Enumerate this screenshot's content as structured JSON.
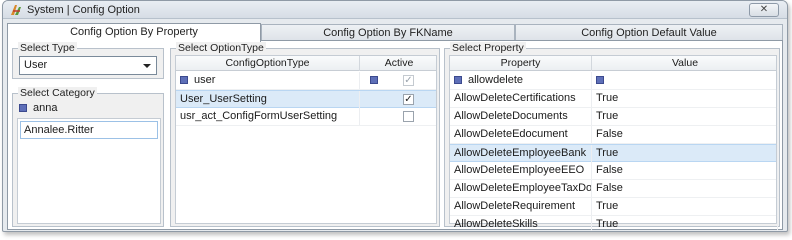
{
  "window": {
    "title": "System | Config Option",
    "close_glyph": "✕"
  },
  "tabs": [
    {
      "label": "Config Option By Property",
      "active": true
    },
    {
      "label": "Config Option By FKName",
      "active": false
    },
    {
      "label": "Config Option Default Value",
      "active": false
    }
  ],
  "select_type": {
    "label": "Select Type",
    "value": "User"
  },
  "select_category": {
    "label": "Select Category",
    "filter_value": "anna",
    "items": [
      "Annalee.Ritter"
    ]
  },
  "select_option_type": {
    "label": "Select OptionType",
    "columns": [
      "ConfigOptionType",
      "Active"
    ],
    "filter_value": "user",
    "rows": [
      {
        "name": "User_UserSetting",
        "active": true,
        "selected": true
      },
      {
        "name": "usr_act_ConfigFormUserSetting",
        "active": false,
        "selected": false
      }
    ]
  },
  "select_property": {
    "label": "Select Property",
    "columns": [
      "Property",
      "Value"
    ],
    "filter_value": "allowdelete",
    "rows": [
      {
        "property": "AllowDeleteCertifications",
        "value": "True",
        "selected": false
      },
      {
        "property": "AllowDeleteDocuments",
        "value": "True",
        "selected": false
      },
      {
        "property": "AllowDeleteEdocument",
        "value": "False",
        "selected": false
      },
      {
        "property": "AllowDeleteEmployeeBank",
        "value": "True",
        "selected": true
      },
      {
        "property": "AllowDeleteEmployeeEEO",
        "value": "False",
        "selected": false
      },
      {
        "property": "AllowDeleteEmployeeTaxDocument",
        "value": "False",
        "selected": false
      },
      {
        "property": "AllowDeleteRequirement",
        "value": "True",
        "selected": false
      },
      {
        "property": "AllowDeleteSkills",
        "value": "True",
        "selected": false
      }
    ]
  }
}
